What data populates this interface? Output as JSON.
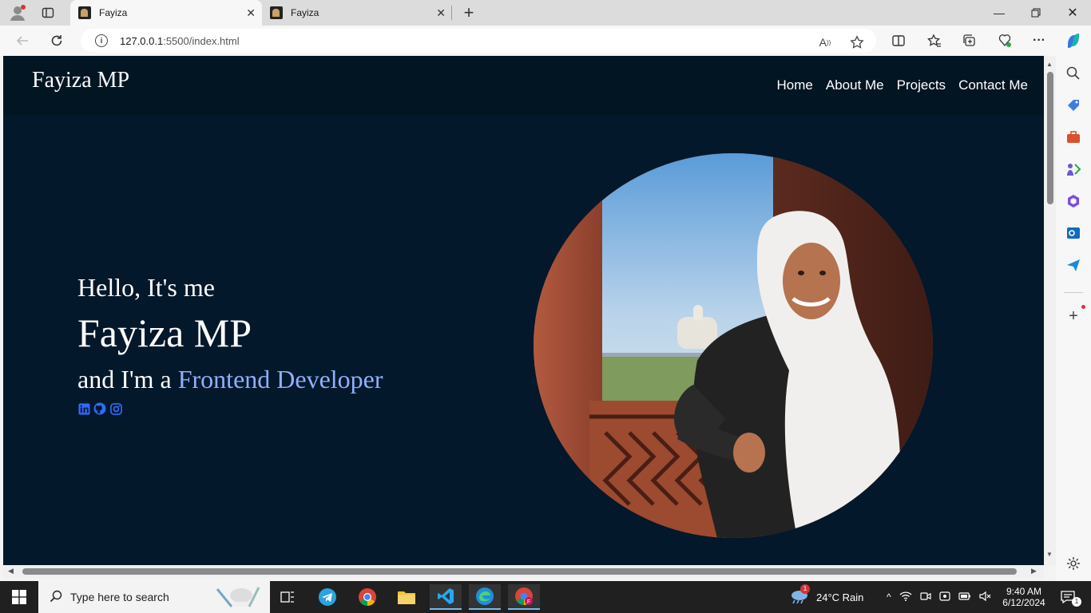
{
  "browser": {
    "tabs": [
      {
        "title": "Fayiza",
        "active": true
      },
      {
        "title": "Fayiza",
        "active": false
      }
    ],
    "url_host": "127.0.0.1",
    "url_path": ":5500/index.html"
  },
  "page": {
    "logo": "Fayiza MP",
    "menu": [
      "Home",
      "About Me",
      "Projects",
      "Contact Me"
    ],
    "greeting": "Hello, It's me",
    "name": "Fayiza MP",
    "role_prefix": "and I'm a ",
    "role_highlight": "Frontend Developer",
    "socials": [
      "linkedin-icon",
      "github-icon",
      "instagram-icon"
    ],
    "colors": {
      "background": "#03182a",
      "navbar": "#021522",
      "highlight": "#8fb0ff",
      "social": "#2f6bff"
    }
  },
  "taskbar": {
    "search_placeholder": "Type here to search",
    "weather": "24°C  Rain",
    "weather_badge": "1",
    "time": "9:40 AM",
    "date": "6/12/2024",
    "notifications": "1"
  }
}
